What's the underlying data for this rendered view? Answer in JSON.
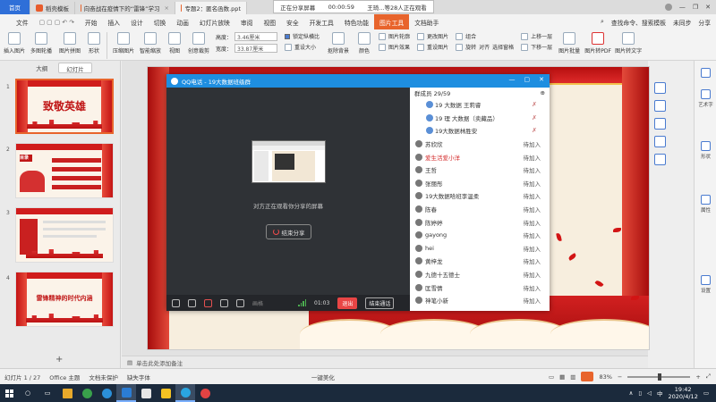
{
  "tabs": [
    {
      "label": "首页"
    },
    {
      "label": "稻壳模板"
    },
    {
      "label": "向奋战在疫情下的“雷锋”学习"
    },
    {
      "label": "专题2：匿名函数.ppt"
    }
  ],
  "share_bar": {
    "status": "正在分享屏幕",
    "timer": "00:00:59",
    "viewers": "王琦...等28人正在观看"
  },
  "menu": {
    "file": "文件",
    "items": [
      "开始",
      "插入",
      "设计",
      "切换",
      "动画",
      "幻灯片放映",
      "审阅",
      "视图",
      "安全",
      "开发工具",
      "特色功能",
      "图片工具",
      "文档助手"
    ],
    "selected": "图片工具",
    "search": "查找命令、搜索模板",
    "sync": "未同步",
    "share": "分享"
  },
  "ribbon": {
    "buttons": [
      "插入图片",
      "多图轮播",
      "图片拼图",
      "形状",
      "压缩图片",
      "智能缩放",
      "视图",
      "创意裁剪",
      "抠除背景",
      "颜色",
      "图片批量",
      "图片转PDF",
      "图片转文字"
    ],
    "height_label": "高度：",
    "height_value": "3.46厘米",
    "width_label": "宽度：",
    "width_value": "33.87厘米",
    "lock_ratio": "锁定纵横比",
    "reset_size": "重设大小",
    "outline": "图片轮廓",
    "effect": "图片效果",
    "change": "更改图片",
    "reset": "重设图片",
    "combine": "组合",
    "rotate": "旋转",
    "align": "对齐",
    "select_pane": "选择窗格",
    "up_layer": "上移一层",
    "down_layer": "下移一层"
  },
  "left_panel": {
    "tabs": [
      "大纲",
      "幻灯片"
    ],
    "selected_tab": "幻灯片",
    "slides": [
      {
        "num": "1",
        "title": "致敬英雄"
      },
      {
        "num": "2",
        "title": "目录"
      },
      {
        "num": "3",
        "title": ""
      },
      {
        "num": "4",
        "title": "雷锋精神的时代内涵"
      }
    ]
  },
  "qq": {
    "title": "QQ电话 - 19大数据班级群",
    "share_hint": "对方正在观看你分享的屏幕",
    "end_share": "结束分享",
    "bottom": {
      "timer": "01:03",
      "quit": "退出",
      "end_call": "结束通话",
      "text_label": "画格"
    },
    "list_header": "群成员 29/59",
    "members": [
      {
        "name": "19 大数据 王莉睿",
        "status": ""
      },
      {
        "name": "19 理 大数据（卖藏品）",
        "status": ""
      },
      {
        "name": "19大数据林胜安",
        "status": ""
      },
      {
        "name": "苏欣欣",
        "status": "待加入"
      },
      {
        "name": "爱生活爱小洋",
        "status": "待加入"
      },
      {
        "name": "王哲",
        "status": "待加入"
      },
      {
        "name": "张丽彤",
        "status": "待加入"
      },
      {
        "name": "19大数据哈班李温柔",
        "status": "待加入"
      },
      {
        "name": "陈春",
        "status": "待加入"
      },
      {
        "name": "陈婷婷",
        "status": "待加入"
      },
      {
        "name": "gayong",
        "status": "待加入"
      },
      {
        "name": "hei",
        "status": "待加入"
      },
      {
        "name": "黄梓龙",
        "status": "待加入"
      },
      {
        "name": "九德十五德士",
        "status": "待加入"
      },
      {
        "name": "匡雪情",
        "status": "待加入"
      },
      {
        "name": "神笔小新",
        "status": "待加入"
      }
    ]
  },
  "right_side": [
    "艺术字",
    "形状",
    "属性",
    "设置"
  ],
  "notes": {
    "placeholder": "单击此处添加备注"
  },
  "status": {
    "slide": "幻灯片 1 / 27",
    "theme": "Office 主题",
    "protect": "文档未保护",
    "font": "缺失字体",
    "beautify": "一键美化",
    "zoom": "83%"
  },
  "taskbar": {
    "time": "19:42",
    "date": "2020/4/12"
  },
  "colors": {
    "accent": "#e8642c",
    "qq_blue": "#1e8ee0",
    "taskbar": "#1b2a3c"
  }
}
